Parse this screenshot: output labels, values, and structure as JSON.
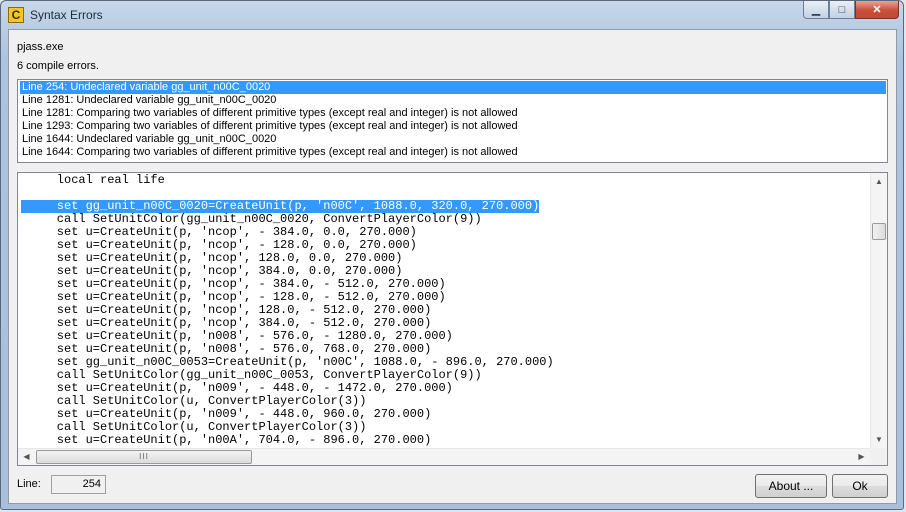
{
  "window": {
    "title": "Syntax Errors",
    "app_icon_letter": "C",
    "caption_buttons": {
      "minimize": "▁",
      "maximize": "□",
      "close": "✕"
    }
  },
  "header": {
    "program": "pjass.exe",
    "summary": "6 compile errors."
  },
  "errors": [
    "Line 254:  Undeclared variable gg_unit_n00C_0020",
    "Line 1281:  Undeclared variable gg_unit_n00C_0020",
    "Line 1281:  Comparing two variables of different primitive types (except real and integer) is not allowed",
    "Line 1293:  Comparing two variables of different primitive types (except real and integer) is not allowed",
    "Line 1644:  Undeclared variable gg_unit_n00C_0020",
    "Line 1644:  Comparing two variables of different primitive types (except real and integer) is not allowed"
  ],
  "selected_error_index": 0,
  "code_lines": [
    "    local real life",
    "",
    "    set gg_unit_n00C_0020=CreateUnit(p, 'n00C', 1088.0, 320.0, 270.000)",
    "    call SetUnitColor(gg_unit_n00C_0020, ConvertPlayerColor(9))",
    "    set u=CreateUnit(p, 'ncop', - 384.0, 0.0, 270.000)",
    "    set u=CreateUnit(p, 'ncop', - 128.0, 0.0, 270.000)",
    "    set u=CreateUnit(p, 'ncop', 128.0, 0.0, 270.000)",
    "    set u=CreateUnit(p, 'ncop', 384.0, 0.0, 270.000)",
    "    set u=CreateUnit(p, 'ncop', - 384.0, - 512.0, 270.000)",
    "    set u=CreateUnit(p, 'ncop', - 128.0, - 512.0, 270.000)",
    "    set u=CreateUnit(p, 'ncop', 128.0, - 512.0, 270.000)",
    "    set u=CreateUnit(p, 'ncop', 384.0, - 512.0, 270.000)",
    "    set u=CreateUnit(p, 'n008', - 576.0, - 1280.0, 270.000)",
    "    set u=CreateUnit(p, 'n008', - 576.0, 768.0, 270.000)",
    "    set gg_unit_n00C_0053=CreateUnit(p, 'n00C', 1088.0, - 896.0, 270.000)",
    "    call SetUnitColor(gg_unit_n00C_0053, ConvertPlayerColor(9))",
    "    set u=CreateUnit(p, 'n009', - 448.0, - 1472.0, 270.000)",
    "    call SetUnitColor(u, ConvertPlayerColor(3))",
    "    set u=CreateUnit(p, 'n009', - 448.0, 960.0, 270.000)",
    "    call SetUnitColor(u, ConvertPlayerColor(3))",
    "    set u=CreateUnit(p, 'n00A', 704.0, - 896.0, 270.000)"
  ],
  "highlighted_code_line_index": 2,
  "footer": {
    "line_label": "Line:",
    "line_value": "254",
    "about_label": "About ...",
    "ok_label": "Ok"
  },
  "scrollbars": {
    "up_arrow": "▲",
    "down_arrow": "▼",
    "left_arrow": "◀",
    "right_arrow": "▶",
    "hthumb_grip": "III"
  },
  "colors": {
    "selection": "#3399ff",
    "close_button": "#c7503a",
    "title_bar": "#b9cbe2"
  }
}
